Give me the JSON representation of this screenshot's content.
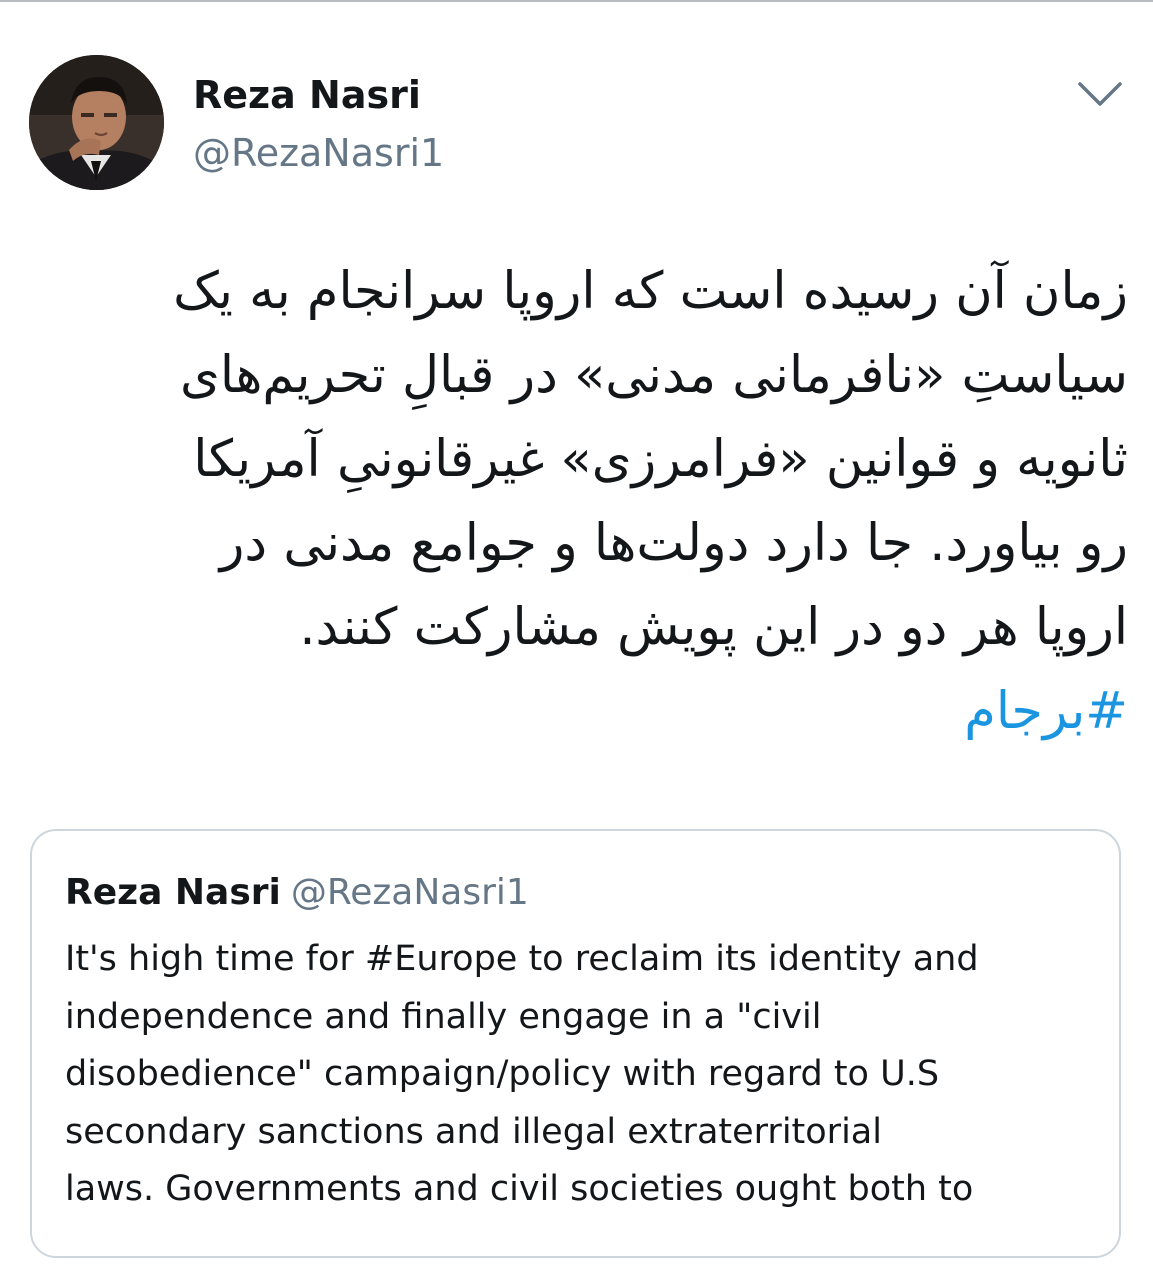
{
  "tweet": {
    "author": {
      "display_name": "Reza Nasri",
      "handle": "@RezaNasri1",
      "avatar_icon": "profile-photo"
    },
    "menu_icon": "chevron-down-icon",
    "text_lines": [
      "زمان آن رسیده است که اروپا سرانجام به یک",
      "سیاستِ «نافرمانی مدنی» در قبالِ تحریم‌های",
      "ثانویه و قوانین «فرامرزی» غیرقانونیِ آمریکا",
      "رو بیاورد. جا دارد دولت‌ها و جوامع مدنی در",
      "اروپا هر دو در این پویش مشارکت کنند."
    ],
    "hashtag": "#برجام"
  },
  "quoted_tweet": {
    "display_name": "Reza Nasri",
    "handle": "@RezaNasri1",
    "text_lines": [
      "It's high time for #Europe to reclaim its identity and",
      "independence and finally engage in a \"civil",
      "disobedience\" campaign/policy with regard to U.S",
      "secondary sanctions and illegal extraterritorial",
      "laws. Governments and civil societies ought both to"
    ]
  },
  "colors": {
    "text": "#14171a",
    "secondary": "#657786",
    "link": "#1b95e0",
    "border": "#ccd6dd"
  }
}
